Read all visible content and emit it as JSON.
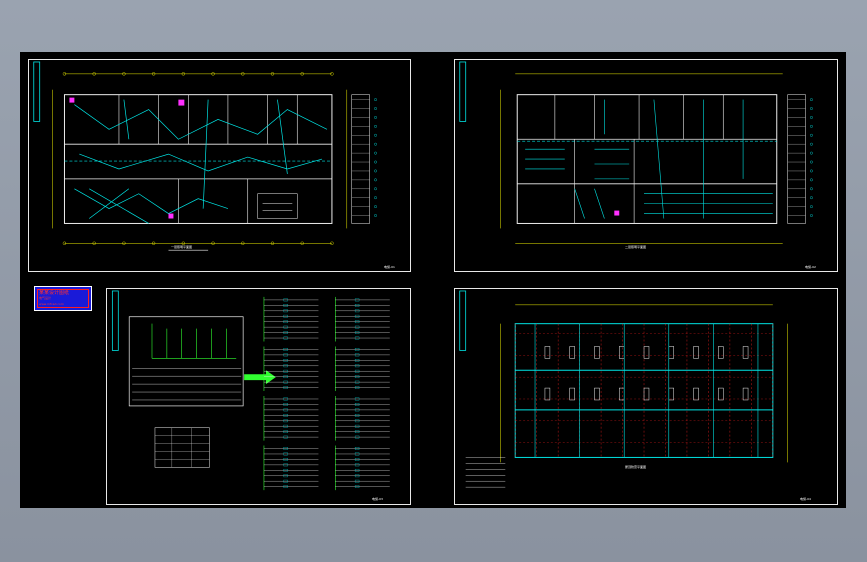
{
  "workspace": {
    "background": "#8c95a3",
    "canvas_background": "#000000"
  },
  "legend_stamp": {
    "title": "某某设计图纸",
    "subtitle": "电气设计",
    "note": "www.mfcad.com"
  },
  "sheets": [
    {
      "name": "first-floor-lighting-plan",
      "caption": "一层照明平面图",
      "tag": "电施-01"
    },
    {
      "name": "second-floor-lighting-plan",
      "caption": "二层照明平面图",
      "tag": "电施-02"
    },
    {
      "name": "power-distribution-system",
      "caption": "配电系统图",
      "tag": "电施-03"
    },
    {
      "name": "roof-lightning-plan",
      "caption": "屋顶防雷平面图",
      "tag": "电施-04"
    }
  ],
  "colors": {
    "cyan": "#00e5e5",
    "white": "#f0f0f0",
    "yellow": "#f0f000",
    "red": "#ff2020",
    "magenta": "#ff30ff",
    "green": "#30ff30",
    "blue": "#2020e0"
  }
}
